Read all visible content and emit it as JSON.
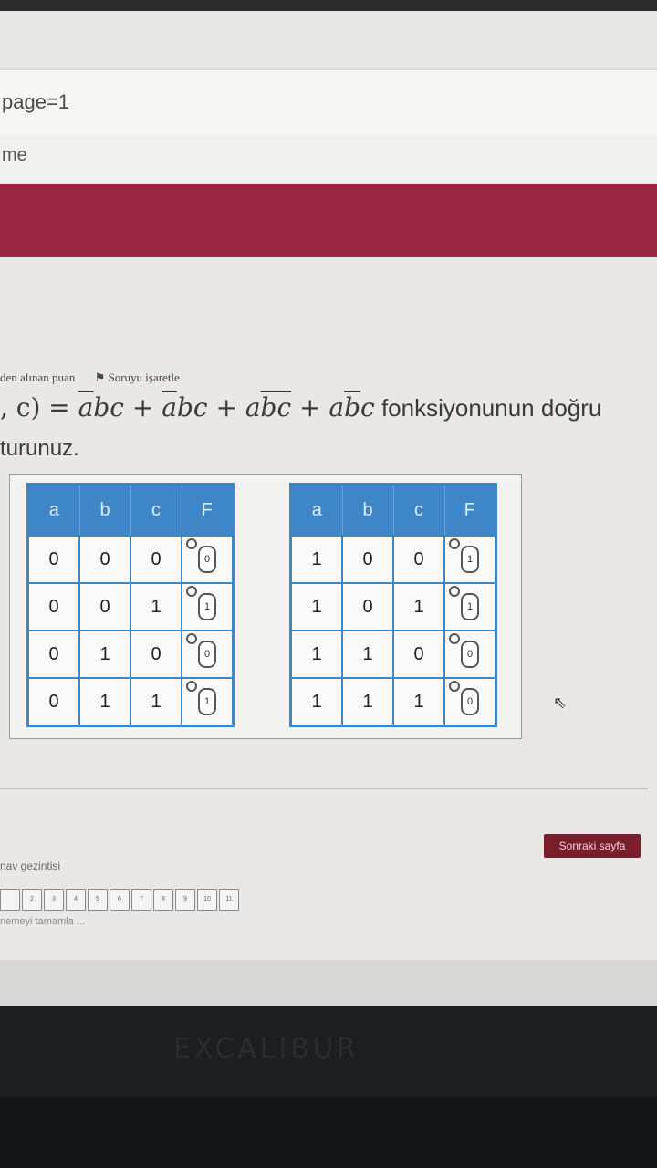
{
  "browser": {
    "url_fragment": "page=1",
    "bookmark_fragment": "me"
  },
  "question": {
    "points_label": "den alınan puan",
    "flag_label": "Soruyu işaretle",
    "formula_prefix": ", c) = ",
    "text_tail": " fonksiyonunun doğru",
    "text_line2": "turunuz."
  },
  "truth_tables": {
    "headers": [
      "a",
      "b",
      "c",
      "F"
    ],
    "left_rows": [
      {
        "a": "0",
        "b": "0",
        "c": "0",
        "f": "0"
      },
      {
        "a": "0",
        "b": "0",
        "c": "1",
        "f": "1"
      },
      {
        "a": "0",
        "b": "1",
        "c": "0",
        "f": "0"
      },
      {
        "a": "0",
        "b": "1",
        "c": "1",
        "f": "1"
      }
    ],
    "right_rows": [
      {
        "a": "1",
        "b": "0",
        "c": "0",
        "f": "1"
      },
      {
        "a": "1",
        "b": "0",
        "c": "1",
        "f": "1"
      },
      {
        "a": "1",
        "b": "1",
        "c": "0",
        "f": "0"
      },
      {
        "a": "1",
        "b": "1",
        "c": "1",
        "f": "0"
      }
    ]
  },
  "navigation": {
    "next_button": "Sonraki sayfa",
    "quiz_nav_label": "nav gezintisi",
    "finish_label": "nemeyi tamamla ...",
    "pages": [
      "",
      "2",
      "3",
      "4",
      "5",
      "6",
      "7",
      "8",
      "9",
      "10",
      "11"
    ]
  },
  "monitor": {
    "brand": "EXCALIBUR"
  }
}
